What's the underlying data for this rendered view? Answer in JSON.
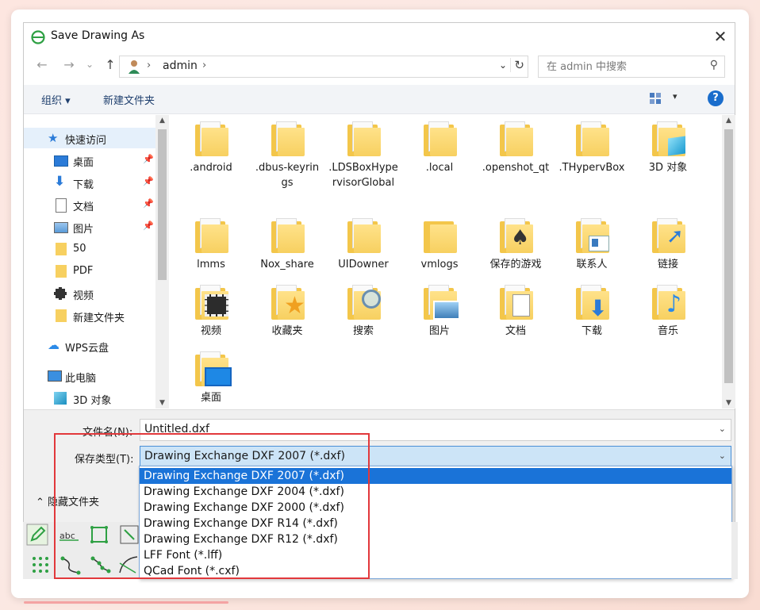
{
  "window": {
    "title": "Save Drawing As",
    "close_symbol": "✕"
  },
  "nav": {
    "back": "←",
    "forward": "→",
    "recent": "⌄",
    "up": "↑",
    "breadcrumb": [
      "admin"
    ],
    "refresh_symbol": "↻"
  },
  "search": {
    "placeholder": "在 admin 中搜索"
  },
  "toolbar": {
    "organize": "组织 ▾",
    "new_folder": "新建文件夹",
    "help": "?"
  },
  "sidebar": {
    "items": [
      {
        "label": "快速访问",
        "icon": "star-icon",
        "color": "#2b7bd8"
      },
      {
        "label": "桌面",
        "icon": "desktop-icon",
        "pinned": true
      },
      {
        "label": "下载",
        "icon": "download-icon",
        "pinned": true
      },
      {
        "label": "文档",
        "icon": "documents-icon",
        "pinned": true
      },
      {
        "label": "图片",
        "icon": "pictures-icon",
        "pinned": true
      },
      {
        "label": "50",
        "icon": "folder-icon"
      },
      {
        "label": "PDF",
        "icon": "folder-icon"
      },
      {
        "label": "视频",
        "icon": "videos-icon"
      },
      {
        "label": "新建文件夹",
        "icon": "folder-icon"
      },
      {
        "label": "WPS云盘",
        "icon": "cloud-icon"
      },
      {
        "label": "此电脑",
        "icon": "computer-icon"
      },
      {
        "label": "3D 对象",
        "icon": "3d-objects-icon"
      }
    ]
  },
  "files": [
    {
      "label": ".android",
      "icon": "folder-doc-icon"
    },
    {
      "label": ".dbus-keyrings",
      "icon": "folder-doc-icon"
    },
    {
      "label": ".LDSBoxHypervisorGlobal",
      "icon": "folder-doc-icon"
    },
    {
      "label": ".local",
      "icon": "folder-doc-icon"
    },
    {
      "label": ".openshot_qt",
      "icon": "folder-doc-icon"
    },
    {
      "label": ".THypervBox",
      "icon": "folder-doc-icon"
    },
    {
      "label": "3D 对象",
      "icon": "folder-3d-icon"
    },
    {
      "label": "lmms",
      "icon": "folder-doc-icon"
    },
    {
      "label": "Nox_share",
      "icon": "folder-doc-icon"
    },
    {
      "label": "UIDowner",
      "icon": "folder-doc-icon"
    },
    {
      "label": "vmlogs",
      "icon": "folder-icon"
    },
    {
      "label": "保存的游戏",
      "icon": "saved-games-icon"
    },
    {
      "label": "联系人",
      "icon": "contacts-icon"
    },
    {
      "label": "链接",
      "icon": "links-icon"
    },
    {
      "label": "视频",
      "icon": "videos-folder-icon"
    },
    {
      "label": "收藏夹",
      "icon": "favorites-icon"
    },
    {
      "label": "搜索",
      "icon": "searches-icon"
    },
    {
      "label": "图片",
      "icon": "pictures-folder-icon"
    },
    {
      "label": "文档",
      "icon": "documents-folder-icon"
    },
    {
      "label": "下载",
      "icon": "downloads-folder-icon"
    },
    {
      "label": "音乐",
      "icon": "music-folder-icon"
    },
    {
      "label": "桌面",
      "icon": "desktop-folder-icon"
    }
  ],
  "filename": {
    "label": "文件名(N):",
    "value": "Untitled.dxf"
  },
  "filetype": {
    "label": "保存类型(T):",
    "value": "Drawing Exchange DXF 2007 (*.dxf)",
    "options": [
      "Drawing Exchange DXF 2007 (*.dxf)",
      "Drawing Exchange DXF 2004 (*.dxf)",
      "Drawing Exchange DXF 2000 (*.dxf)",
      "Drawing Exchange DXF R14 (*.dxf)",
      "Drawing Exchange DXF R12 (*.dxf)",
      "LFF Font (*.lff)",
      "QCad Font (*.cxf)"
    ],
    "selected_index": 0
  },
  "hide_folders": "⌃ 隐藏文件夹",
  "colors": {
    "highlight": "#1a73d8",
    "annotation": "#e2383b",
    "folder": "#f7d060"
  }
}
